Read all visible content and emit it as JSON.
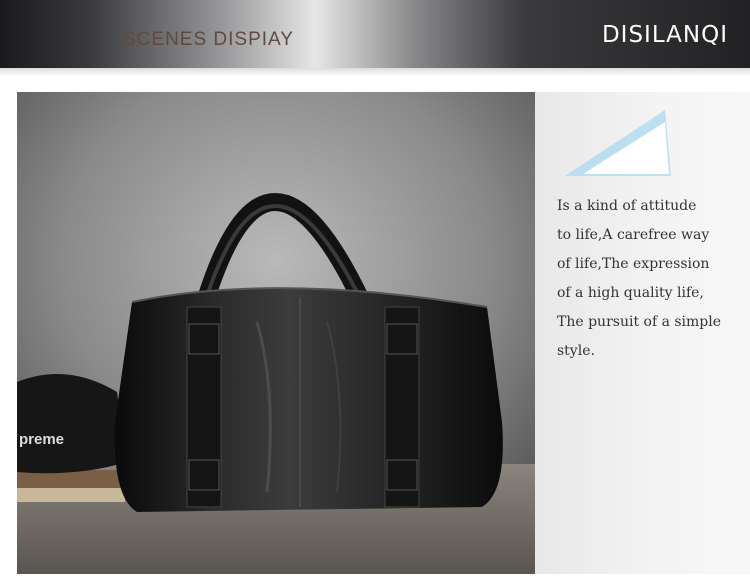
{
  "banner": {
    "subtitle": "SCENES DISPIAY",
    "brand": "DISILANQI"
  },
  "photo": {
    "cap_text": "preme",
    "subject": "black-leather-duffel-bag"
  },
  "tagline": {
    "lines": [
      "Is a kind of attitude",
      "to life,A carefree way",
      "of life,The expression",
      "of a high quality life,",
      "The pursuit of a simple",
      "style."
    ]
  },
  "colors": {
    "accent": "#a9d8f2",
    "subtitle": "#5e4a3e",
    "brand": "#ffffff",
    "text": "#333333"
  }
}
